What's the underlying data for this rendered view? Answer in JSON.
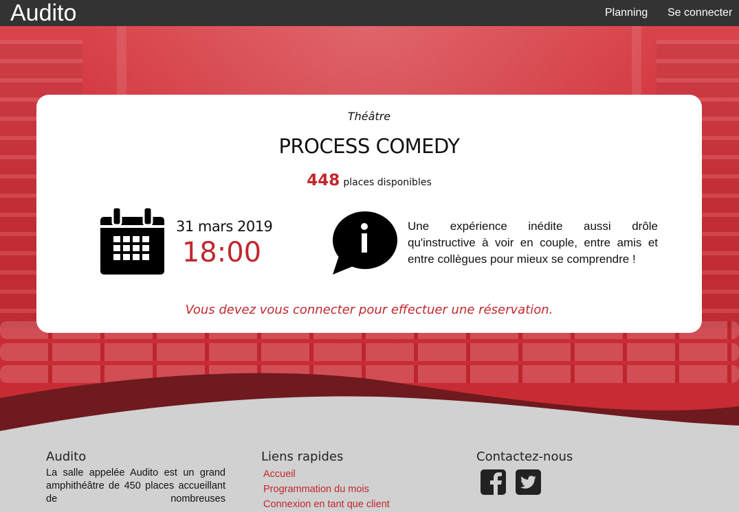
{
  "navbar": {
    "brand": "Audito",
    "links": [
      "Planning",
      "Se connecter"
    ]
  },
  "event": {
    "category": "Théâtre",
    "title": "PROCESS COMEDY",
    "places_count": "448",
    "places_label": "places disponibles",
    "date": "31 mars 2019",
    "time": "18:00",
    "description": "Une expérience inédite aussi drôle qu'instructive à voir en couple, entre amis et entre collègues pour mieux se comprendre !",
    "login_message": "Vous devez vous connecter pour effectuer une réservation.",
    "icons": [
      "calendar-icon",
      "info-speech-bubble-icon"
    ]
  },
  "footer": {
    "about": {
      "heading": "Audito",
      "text": "La salle appelée Audito est un grand amphithéâtre de 450 places accueillant de nombreuses"
    },
    "quick_links": {
      "heading": "Liens rapides",
      "items": [
        "Accueil",
        "Programmation du mois",
        "Connexion en tant que client"
      ]
    },
    "contact": {
      "heading": "Contactez-nous",
      "icons": [
        "facebook-icon",
        "twitter-icon"
      ]
    }
  },
  "colors": {
    "accent": "#c0272d",
    "navbar": "#333333",
    "hero": "#cc2f38",
    "wave": "#6e1a1f",
    "footer": "#d1d1d1"
  }
}
